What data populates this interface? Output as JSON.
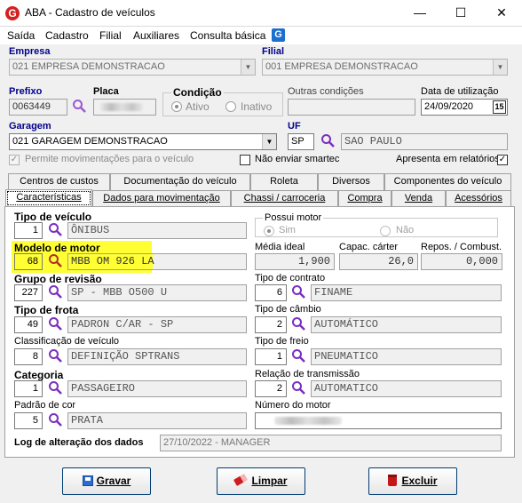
{
  "window": {
    "title": "ABA - Cadastro de veículos",
    "icon": "app-g-icon"
  },
  "menu": [
    "Saída",
    "Cadastro",
    "Filial",
    "Auxiliares",
    "Consulta básica"
  ],
  "header": {
    "empresa_label": "Empresa",
    "empresa_value": "021 EMPRESA DEMONSTRACAO",
    "filial_label": "Filial",
    "filial_value": "001 EMPRESA DEMONSTRACAO",
    "prefixo_label": "Prefixo",
    "prefixo_value": "0063449",
    "placa_label": "Placa",
    "condicao_label": "Condição",
    "condicao_ativo": "Ativo",
    "condicao_inativo": "Inativo",
    "outras_label": "Outras condições",
    "data_label": "Data de utilização",
    "data_value": "24/09/2020",
    "calendar_text": "15",
    "garagem_label": "Garagem",
    "garagem_value": "021 GARAGEM DEMONSTRACAO",
    "uf_label": "UF",
    "uf_value": "SP",
    "uf_name": "SAO PAULO",
    "permite_label": "Permite movimentações para o veículo",
    "smartec_label": "Não enviar smartec",
    "relatorios_label": "Apresenta em relatórios"
  },
  "tabs_row1": [
    "Centros de custos",
    "Documentação do veículo",
    "Roleta",
    "Diversos",
    "Componentes do veículo"
  ],
  "tabs_row2": [
    "Características",
    "Dados para movimentação",
    "Chassi / carroceria",
    "Compra",
    "Venda",
    "Acessórios"
  ],
  "caracteristicas": {
    "tipo_veiculo": {
      "label": "Tipo de veículo",
      "code": "1",
      "value": "ÔNIBUS"
    },
    "possui_motor": {
      "label": "Possui motor",
      "sim": "Sim",
      "nao": "Não"
    },
    "modelo_motor": {
      "label": "Modelo de motor",
      "code": "68",
      "value": "MBB OM 926 LA"
    },
    "media_ideal": {
      "label": "Média ideal",
      "value": "1,900"
    },
    "capac_carter": {
      "label": "Capac. cárter",
      "value": "26,0"
    },
    "repos_combust": {
      "label": "Repos. / Combust.",
      "value": "0,000"
    },
    "grupo_revisao": {
      "label": "Grupo de revisão",
      "code": "227",
      "value": "SP - MBB O500 U"
    },
    "tipo_contrato": {
      "label": "Tipo de contrato",
      "code": "6",
      "value": "FINAME"
    },
    "tipo_frota": {
      "label": "Tipo de frota",
      "code": "49",
      "value": "PADRON C/AR - SP"
    },
    "tipo_cambio": {
      "label": "Tipo de câmbio",
      "code": "2",
      "value": "AUTOMÁTICO"
    },
    "classificacao": {
      "label": "Classificação de veículo",
      "code": "8",
      "value": "DEFINIÇÃO SPTRANS"
    },
    "tipo_freio": {
      "label": "Tipo de freio",
      "code": "1",
      "value": "PNEUMATICO"
    },
    "categoria": {
      "label": "Categoria",
      "code": "1",
      "value": "PASSAGEIRO"
    },
    "relacao_transmissao": {
      "label": "Relação de transmissão",
      "code": "2",
      "value": "AUTOMATICO"
    },
    "padrao_cor": {
      "label": "Padrão de cor",
      "code": "5",
      "value": "PRATA"
    },
    "numero_motor": {
      "label": "Número do motor"
    },
    "log": {
      "label": "Log de alteração dos dados",
      "value": "27/10/2022 - MANAGER"
    }
  },
  "buttons": {
    "gravar": "Gravar",
    "limpar": "Limpar",
    "excluir": "Excluir"
  },
  "colors": {
    "accent_label": "#00008b",
    "search_icon": "#7b2fbe",
    "highlight": "#ffff33",
    "button_border": "#003c74"
  }
}
